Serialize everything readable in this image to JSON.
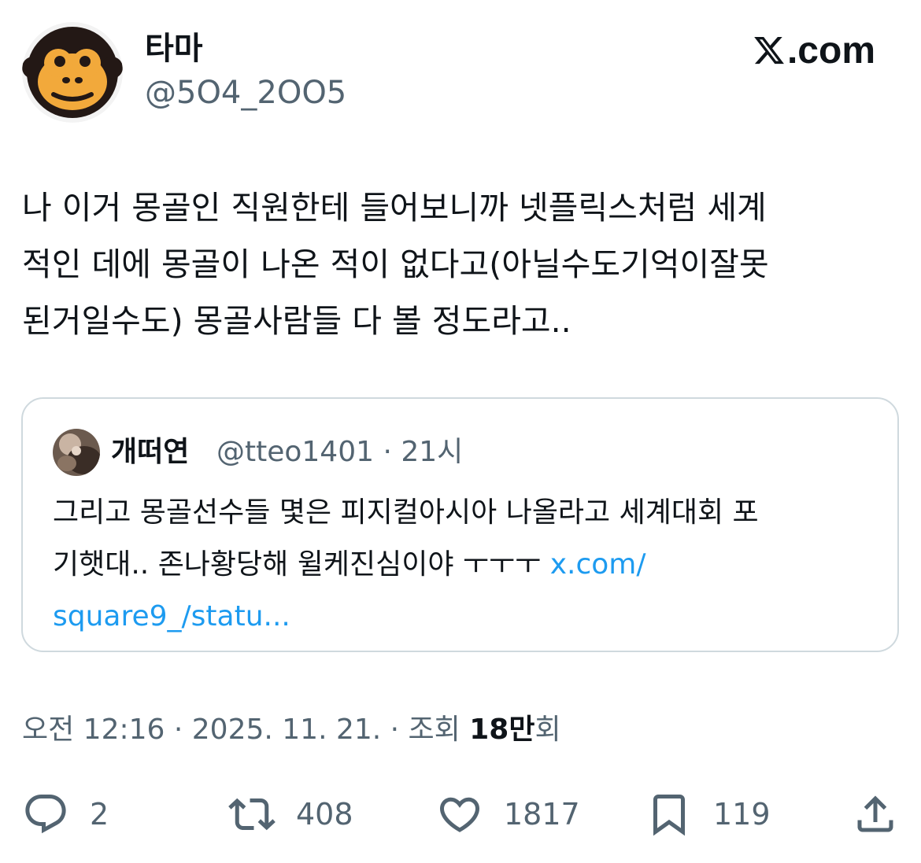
{
  "author": {
    "display_name": "타마",
    "handle": "@5O4_2OO5",
    "avatar": "monkey-face-avatar"
  },
  "brand": {
    "label": ".com",
    "icon": "x-logo-icon"
  },
  "tweet": {
    "text": "나 이거 몽골인 직원한테 들어보니까 넷플릭스처럼 세계\n적인 데에 몽골이 나온 적이 없다고(아닐수도기억이잘못\n된거일수도) 몽골사람들 다 볼 정도라고.."
  },
  "quoted_tweet": {
    "display_name": "개떠연",
    "handle_time": "@tteo1401 · 21시",
    "text": "그리고 몽골선수들 몇은 피지컬아시아 나올라고 세계대회 포\n기햇대.. 존나황당해 윌케진심이야 ㅜㅜㅜ ",
    "link_part1": "x.com/",
    "link_part2": "square9_/statu..."
  },
  "meta": {
    "timestamp": "오전 12:16 · 2025. 11. 21. · 조회 ",
    "views_count": "18만",
    "views_suffix": "회"
  },
  "actions": {
    "replies": "2",
    "retweets": "408",
    "likes": "1817",
    "bookmarks": "119"
  },
  "colors": {
    "text": "#0f1419",
    "secondary": "#536471",
    "link": "#1d9bf0",
    "border": "#cfd9de",
    "avatar_face": "#f2a93b"
  }
}
